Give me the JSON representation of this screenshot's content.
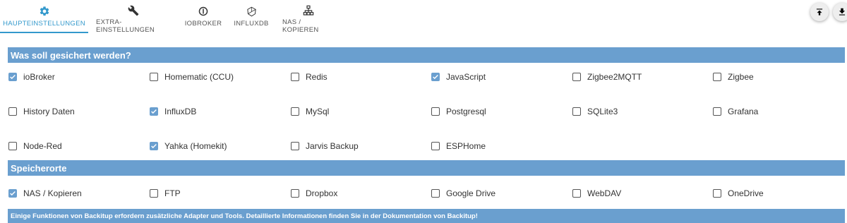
{
  "tabs": [
    {
      "label": "HAUPTEINSTELLUNGEN",
      "icon": "gear-icon",
      "active": true
    },
    {
      "label": "EXTRA-EINSTELLUNGEN",
      "icon": "wrench-icon",
      "active": false
    },
    {
      "label": "IOBROKER",
      "icon": "iobroker-icon",
      "active": false
    },
    {
      "label": "INFLUXDB",
      "icon": "influxdb-icon",
      "active": false
    },
    {
      "label": "NAS / KOPIEREN",
      "icon": "network-icon",
      "active": false
    }
  ],
  "actions": {
    "upload_icon": "upload-icon",
    "download_icon": "download-icon"
  },
  "backup_section": {
    "title": "Was soll gesichert werden?",
    "rows": [
      [
        {
          "label": "ioBroker",
          "checked": true
        },
        {
          "label": "Homematic (CCU)",
          "checked": false
        },
        {
          "label": "Redis",
          "checked": false
        },
        {
          "label": "JavaScript",
          "checked": true
        },
        {
          "label": "Zigbee2MQTT",
          "checked": false
        },
        {
          "label": "Zigbee",
          "checked": false
        }
      ],
      [
        {
          "label": "History Daten",
          "checked": false
        },
        {
          "label": "InfluxDB",
          "checked": true
        },
        {
          "label": "MySql",
          "checked": false
        },
        {
          "label": "Postgresql",
          "checked": false
        },
        {
          "label": "SQLite3",
          "checked": false
        },
        {
          "label": "Grafana",
          "checked": false
        }
      ],
      [
        {
          "label": "Node-Red",
          "checked": false
        },
        {
          "label": "Yahka (Homekit)",
          "checked": true
        },
        {
          "label": "Jarvis Backup",
          "checked": false
        },
        {
          "label": "ESPHome",
          "checked": false
        }
      ]
    ]
  },
  "storage_section": {
    "title": "Speicherorte",
    "rows": [
      [
        {
          "label": "NAS / Kopieren",
          "checked": true
        },
        {
          "label": "FTP",
          "checked": false
        },
        {
          "label": "Dropbox",
          "checked": false
        },
        {
          "label": "Google Drive",
          "checked": false
        },
        {
          "label": "WebDAV",
          "checked": false
        },
        {
          "label": "OneDrive",
          "checked": false
        }
      ]
    ]
  },
  "info_banner": {
    "text": "Einige Funktionen von Backitup erfordern zusätzliche Adapter und Tools. Detaillierte Informationen finden Sie in der Dokumentation von Backitup!"
  },
  "colors": {
    "accent": "#3399cc",
    "header_bg": "#6a9fcf"
  }
}
